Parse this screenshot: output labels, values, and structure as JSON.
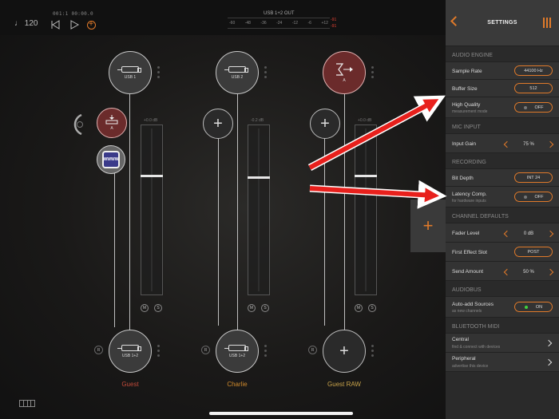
{
  "topbar": {
    "tempo": "♩ 120",
    "timecode": "001:1   00:00.0",
    "meter_title": "USB 1+2 OUT",
    "meter_scale": [
      "-60",
      "-48",
      "-36",
      "-24",
      "-12",
      "-6",
      "+12"
    ],
    "peak_left": "-91",
    "peak_right": "-91"
  },
  "mixer": {
    "channels": [
      {
        "name": "Guest",
        "input_label": "USB 1",
        "fader_value": "+0.0 dB",
        "output_label": "USB 1+2",
        "name_color": "#c24a3a"
      },
      {
        "name": "Charlie",
        "input_label": "USB 2",
        "fader_value": "-0.2 dB",
        "output_label": "USB 1+2",
        "name_color": "#d08a2c"
      },
      {
        "name": "Guest RAW",
        "input_label": "A",
        "fader_value": "+0.0 dB",
        "output_label": "",
        "name_color": "#c8a34a"
      }
    ],
    "effect_node_label": "A",
    "plugin_label": "WWWW",
    "mute_label": "M",
    "solo_label": "S",
    "record_label": "R"
  },
  "settings": {
    "title": "SETTINGS",
    "sections": {
      "audio_engine": "AUDIO ENGINE",
      "mic_input": "MIC INPUT",
      "recording": "RECORDING",
      "channel_defaults": "CHANNEL DEFAULTS",
      "audiobus": "AUDIOBUS",
      "bluetooth_midi": "BLUETOOTH MIDI"
    },
    "sample_rate": {
      "label": "Sample Rate",
      "value": "44100 Hz"
    },
    "buffer_size": {
      "label": "Buffer Size",
      "value": "512"
    },
    "high_quality": {
      "label": "High Quality",
      "sub": "measurement mode",
      "value": "OFF"
    },
    "input_gain": {
      "label": "Input Gain",
      "value": "75 %"
    },
    "bit_depth": {
      "label": "Bit Depth",
      "value": "INT 24"
    },
    "latency_comp": {
      "label": "Latency Comp.",
      "sub": "for hardware inputs",
      "value": "OFF"
    },
    "fader_level": {
      "label": "Fader Level",
      "value": "0 dB"
    },
    "first_effect_slot": {
      "label": "First Effect Slot",
      "value": "POST"
    },
    "send_amount": {
      "label": "Send Amount",
      "value": "50 %"
    },
    "auto_add_sources": {
      "label": "Auto-add Sources",
      "sub": "as new channels",
      "value": "ON"
    },
    "central": {
      "label": "Central",
      "sub": "find & connect with devices"
    },
    "peripheral": {
      "label": "Peripheral",
      "sub": "advertise this device"
    }
  },
  "colors": {
    "accent": "#e07a2a",
    "arrow": "#e8201c",
    "on_led": "#3ed23e"
  }
}
